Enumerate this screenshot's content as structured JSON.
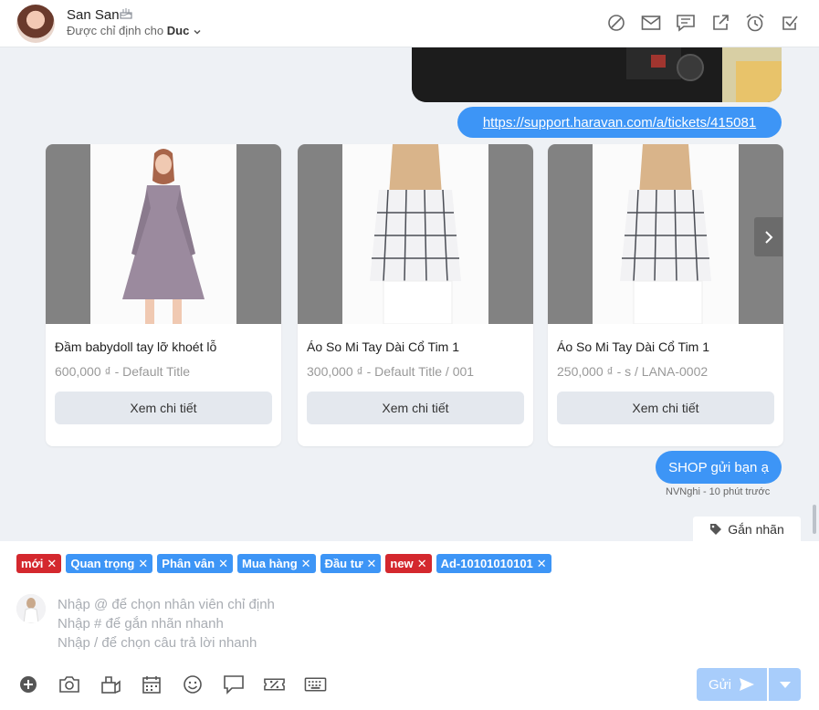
{
  "header": {
    "user_name": "San San",
    "assigned_prefix": "Được chỉ định cho",
    "assignee": "Duc",
    "actions": [
      "block-icon",
      "mail-icon",
      "comment-icon",
      "external-link-icon",
      "alarm-icon",
      "checkbox-icon"
    ]
  },
  "messages": {
    "link": "https://support.haravan.com/a/tickets/415081",
    "shop_text": "SHOP gửi bạn ạ",
    "meta": "NVNghi - 10 phút trước"
  },
  "products": [
    {
      "title": "Đầm babydoll tay lỡ khoét lỗ",
      "subtitle": "600,000 ₫ - Default Title",
      "button": "Xem chi tiết"
    },
    {
      "title": "Áo So Mi Tay Dài Cổ Tim 1",
      "subtitle": "300,000 ₫ - Default Title / 001",
      "button": "Xem chi tiết"
    },
    {
      "title": "Áo So Mi Tay Dài Cổ Tim 1",
      "subtitle": "250,000 ₫ - s / LANA-0002",
      "button": "Xem chi tiết"
    }
  ],
  "tag_tab": "Gắn nhãn",
  "tags": [
    {
      "label": "mới",
      "color": "#d4282e"
    },
    {
      "label": "Quan trọng",
      "color": "#3d95f6"
    },
    {
      "label": "Phân vân",
      "color": "#3d95f6"
    },
    {
      "label": "Mua hàng",
      "color": "#3d95f6"
    },
    {
      "label": "Đầu tư",
      "color": "#3d95f6"
    },
    {
      "label": "new",
      "color": "#d4282e"
    },
    {
      "label": "Ad-10101010101",
      "color": "#3d95f6"
    }
  ],
  "composer": {
    "placeholder_1": "Nhập @ để chọn nhân viên chỉ định",
    "placeholder_2": "Nhập # để gắn nhãn nhanh",
    "placeholder_3": "Nhập / để chọn câu trả lời nhanh",
    "send_label": "Gửi",
    "tools": [
      "plus-icon",
      "camera-icon",
      "product-icon",
      "calendar-icon",
      "emoji-icon",
      "chat-icon",
      "discount-icon",
      "keyboard-icon"
    ]
  },
  "colors": {
    "accent": "#3d95f6",
    "tag_red": "#d4282e",
    "send_disabled": "#a8cdfb"
  }
}
